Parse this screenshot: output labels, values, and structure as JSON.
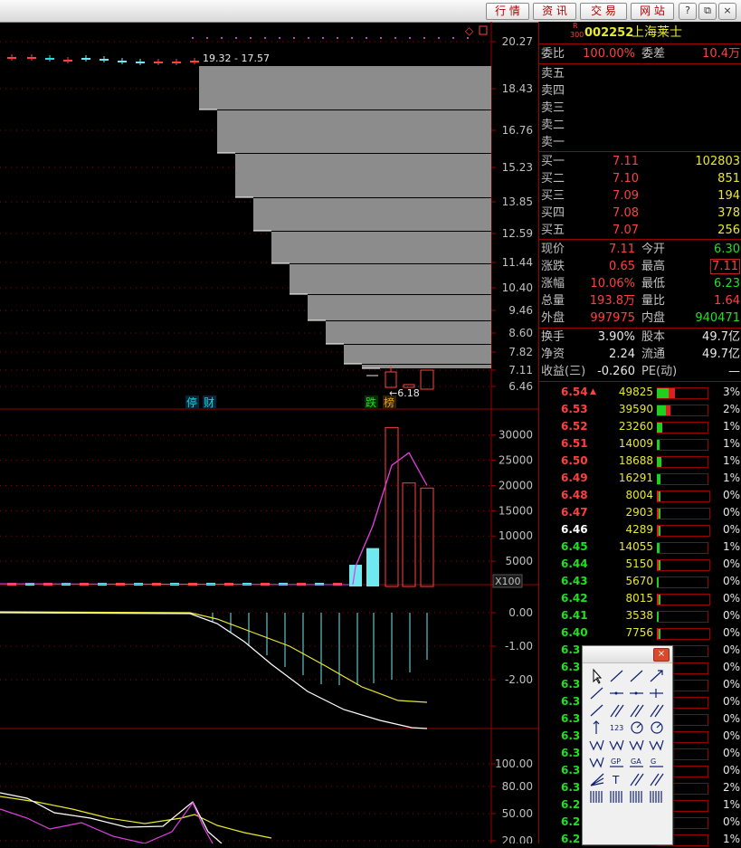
{
  "topbar": {
    "buttons": [
      "行 情",
      "资 讯",
      "交 易",
      "网 站"
    ],
    "window_controls": [
      "?",
      "-",
      "□",
      "×"
    ]
  },
  "stock": {
    "badge_top": "R",
    "badge_bottom": "300",
    "code": "002252",
    "name": "上海莱士"
  },
  "ratio": {
    "label": "委比",
    "value": "100.00%",
    "label2": "委差",
    "value2": "10.4万"
  },
  "asks": [
    {
      "label": "卖五"
    },
    {
      "label": "卖四"
    },
    {
      "label": "卖三"
    },
    {
      "label": "卖二"
    },
    {
      "label": "卖一"
    }
  ],
  "bids": [
    {
      "label": "买一",
      "price": "7.11",
      "vol": "102803"
    },
    {
      "label": "买二",
      "price": "7.10",
      "vol": "851"
    },
    {
      "label": "买三",
      "price": "7.09",
      "vol": "194"
    },
    {
      "label": "买四",
      "price": "7.08",
      "vol": "378"
    },
    {
      "label": "买五",
      "price": "7.07",
      "vol": "256"
    }
  ],
  "quote": [
    {
      "l1": "现价",
      "v1": "7.11",
      "l2": "今开",
      "v2": "6.30",
      "c2": "grn"
    },
    {
      "l1": "涨跌",
      "v1": "0.65",
      "l2": "最高",
      "v2": "7.11",
      "c2": "red"
    },
    {
      "l1": "涨幅",
      "v1": "10.06%",
      "l2": "最低",
      "v2": "6.23",
      "c2": "grn"
    },
    {
      "l1": "总量",
      "v1": "193.8万",
      "l2": "量比",
      "v2": "1.64",
      "c2": "red"
    },
    {
      "l1": "外盘",
      "v1": "997975",
      "l2": "内盘",
      "v2": "940471",
      "c2": "grn"
    }
  ],
  "fund": [
    {
      "l1": "换手",
      "v1": "3.90%",
      "l2": "股本",
      "v2": "49.7亿"
    },
    {
      "l1": "净资",
      "v1": "2.24",
      "l2": "流通",
      "v2": "49.7亿"
    },
    {
      "l1": "收益(三)",
      "v1": "-0.260",
      "l2": "PE(动)",
      "v2": "—"
    }
  ],
  "depth": [
    {
      "price": "6.54",
      "vol": "49825",
      "pct": "3%",
      "bar": 0.75,
      "color": "red",
      "arrow": "▲"
    },
    {
      "price": "6.53",
      "vol": "39590",
      "pct": "2%",
      "bar": 0.6,
      "color": "red"
    },
    {
      "price": "6.52",
      "vol": "23260",
      "pct": "1%",
      "bar": 0.35,
      "color": "red"
    },
    {
      "price": "6.51",
      "vol": "14009",
      "pct": "1%",
      "bar": 0.2,
      "color": "red"
    },
    {
      "price": "6.50",
      "vol": "18688",
      "pct": "1%",
      "bar": 0.28,
      "color": "red"
    },
    {
      "price": "6.49",
      "vol": "16291",
      "pct": "1%",
      "bar": 0.25,
      "color": "red"
    },
    {
      "price": "6.48",
      "vol": "8004",
      "pct": "0%",
      "bar": 0.12,
      "color": "red"
    },
    {
      "price": "6.47",
      "vol": "2903",
      "pct": "0%",
      "bar": 0.05,
      "color": "red"
    },
    {
      "price": "6.46",
      "vol": "4289",
      "pct": "0%",
      "bar": 0.07,
      "color": "wht"
    },
    {
      "price": "6.45",
      "vol": "14055",
      "pct": "1%",
      "bar": 0.2,
      "color": "grn"
    },
    {
      "price": "6.44",
      "vol": "5150",
      "pct": "0%",
      "bar": 0.08,
      "color": "grn"
    },
    {
      "price": "6.43",
      "vol": "5670",
      "pct": "0%",
      "bar": 0.09,
      "color": "grn"
    },
    {
      "price": "6.42",
      "vol": "8015",
      "pct": "0%",
      "bar": 0.12,
      "color": "grn"
    },
    {
      "price": "6.41",
      "vol": "3538",
      "pct": "0%",
      "bar": 0.05,
      "color": "grn"
    },
    {
      "price": "6.40",
      "vol": "7756",
      "pct": "0%",
      "bar": 0.11,
      "color": "grn"
    },
    {
      "price": "6.3",
      "vol": "",
      "pct": "0%",
      "bar": 0,
      "color": "grn"
    },
    {
      "price": "6.3",
      "vol": "",
      "pct": "0%",
      "bar": 0,
      "color": "grn"
    },
    {
      "price": "6.3",
      "vol": "",
      "pct": "0%",
      "bar": 0,
      "color": "grn"
    },
    {
      "price": "6.3",
      "vol": "",
      "pct": "0%",
      "bar": 0,
      "color": "grn"
    },
    {
      "price": "6.3",
      "vol": "",
      "pct": "0%",
      "bar": 0,
      "color": "grn"
    },
    {
      "price": "6.3",
      "vol": "",
      "pct": "0%",
      "bar": 0,
      "color": "grn"
    },
    {
      "price": "6.3",
      "vol": "",
      "pct": "0%",
      "bar": 0,
      "color": "grn"
    },
    {
      "price": "6.3",
      "vol": "",
      "pct": "0%",
      "bar": 0,
      "color": "grn"
    },
    {
      "price": "6.3",
      "vol": "",
      "pct": "2%",
      "bar": 0,
      "color": "grn"
    },
    {
      "price": "6.2",
      "vol": "",
      "pct": "1%",
      "bar": 0,
      "color": "grn"
    },
    {
      "price": "6.2",
      "vol": "",
      "pct": "0%",
      "bar": 0,
      "color": "grn"
    },
    {
      "price": "6.2",
      "vol": "",
      "pct": "1%",
      "bar": 0,
      "color": "grn"
    }
  ],
  "main_chart": {
    "price_ticks": [
      "20.27",
      "18.43",
      "16.76",
      "15.23",
      "13.85",
      "12.59",
      "11.44",
      "10.40",
      "9.46",
      "8.60",
      "7.82",
      "7.11",
      "6.46"
    ],
    "range_label": "19.32 - 17.57",
    "low_label": "6.18",
    "tag_left": [
      "停",
      "财"
    ],
    "tag_right": [
      "跌",
      "榜"
    ],
    "diamond": "◇",
    "corner_box": "□"
  },
  "volume_chart": {
    "ticks": [
      "30000",
      "25000",
      "20000",
      "15000",
      "10000",
      "5000"
    ],
    "unit": "X100",
    "bars": [
      430,
      760,
      3150,
      2050,
      1950
    ],
    "ma": [
      400,
      1200,
      2400,
      2650,
      2000
    ]
  },
  "macd_chart": {
    "ticks": [
      "0.00",
      "-1.00",
      "-2.00"
    ]
  },
  "kdj_chart": {
    "ticks": [
      "100.00",
      "80.00",
      "50.00",
      "20.00"
    ]
  },
  "colors": {
    "up": "#ff4040",
    "down": "#20e020",
    "grid": "#9a0000",
    "vol": "#70e8f0",
    "ma": "#e040e0"
  }
}
